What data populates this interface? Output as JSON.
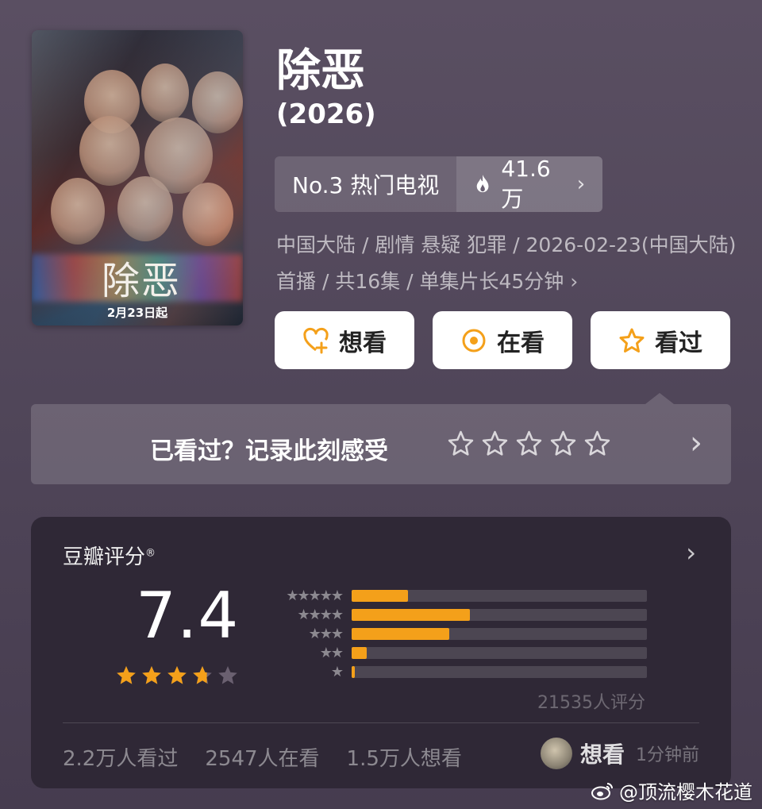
{
  "poster": {
    "title_art": "除恶",
    "date_text": "2月23日起"
  },
  "title": "除恶",
  "year": "(2026)",
  "ranking": {
    "label": "No.3 热门电视",
    "heat": "41.6万"
  },
  "meta": "中国大陆 / 剧情 悬疑 犯罪 / 2026-02-23(中国大陆)首播 / 共16集 / 单集片长45分钟",
  "actions": [
    {
      "label": "想看",
      "icon": "heart-plus-icon"
    },
    {
      "label": "在看",
      "icon": "target-icon"
    },
    {
      "label": "看过",
      "icon": "star-outline-icon"
    }
  ],
  "record": {
    "label": "已看过？记录此刻感受",
    "stars": 5
  },
  "rating": {
    "title": "豆瓣评分",
    "trademark": "®",
    "score": "7.4",
    "star_value": 3.7,
    "distribution": [
      {
        "stars": 5,
        "fraction": 0.19
      },
      {
        "stars": 4,
        "fraction": 0.4
      },
      {
        "stars": 3,
        "fraction": 0.33
      },
      {
        "stars": 2,
        "fraction": 0.05
      },
      {
        "stars": 1,
        "fraction": 0.01
      }
    ],
    "rating_count": "21535人评分"
  },
  "stats": {
    "watched": "2.2万人看过",
    "watching": "2547人在看",
    "want": "1.5万人想看"
  },
  "friend": {
    "action": "想看",
    "time": "1分钟前"
  },
  "watermark": "@顶流樱木花道",
  "colors": {
    "accent": "#f4a01a",
    "card": "#2f2836",
    "background": "#534859"
  }
}
